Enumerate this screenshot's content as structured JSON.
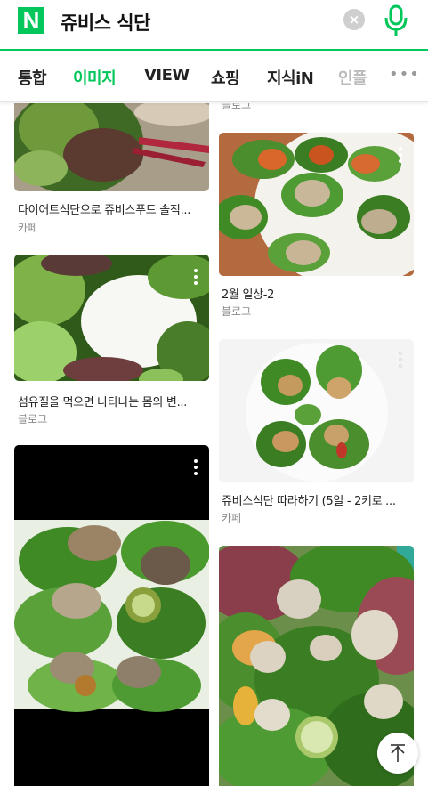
{
  "search": {
    "logo": "N",
    "query": "쥬비스 식단",
    "clear_glyph": "×"
  },
  "tabs": [
    {
      "label": "통합"
    },
    {
      "label": "이미지"
    },
    {
      "label": "VIEW"
    },
    {
      "label": "쇼핑"
    },
    {
      "label": "지식iN"
    },
    {
      "label": "인플"
    }
  ],
  "more_label": "•••",
  "results": [
    {
      "title": "",
      "source": "블로그"
    },
    {
      "title": "다이어트식단으로 쥬비스푸드 솔직...",
      "source": "카페"
    },
    {
      "title": "2월 일상-2",
      "source": "블로그"
    },
    {
      "title": "섬유질을 먹으면 나타나는 몸의 변...",
      "source": "블로그"
    },
    {
      "title": "쥬비스식단 따라하기 (5일 - 2키로 ...",
      "source": "카페"
    },
    {
      "title": "",
      "source": ""
    },
    {
      "title": "",
      "source": ""
    }
  ],
  "colors": {
    "accent": "#03c75a",
    "text": "#222222",
    "muted": "#8a8a8a"
  },
  "icons": [
    "naver-logo-icon",
    "clear-icon",
    "microphone-icon",
    "more-dots-icon",
    "kebab-menu-icon",
    "scroll-top-icon"
  ]
}
